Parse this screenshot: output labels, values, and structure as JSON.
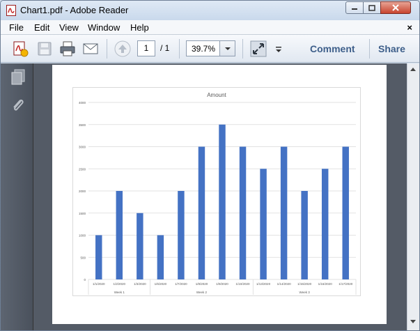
{
  "window": {
    "title": "Chart1.pdf - Adobe Reader"
  },
  "menu": {
    "items": [
      "File",
      "Edit",
      "View",
      "Window",
      "Help"
    ],
    "close_label": "×"
  },
  "toolbar": {
    "page_current": "1",
    "page_total": "/ 1",
    "zoom": "39.7%",
    "comment_label": "Comment",
    "share_label": "Share"
  },
  "chart_data": {
    "type": "bar",
    "title": "Amount",
    "categories": [
      "1/1/2020",
      "1/2/2020",
      "1/3/2020",
      "1/6/2020",
      "1/7/2020",
      "1/8/2020",
      "1/9/2020",
      "1/10/2020",
      "1/13/2020",
      "1/14/2020",
      "1/15/2020",
      "1/16/2020",
      "1/17/2020"
    ],
    "groups": [
      {
        "label": "Week 1",
        "count": 3
      },
      {
        "label": "Week 2",
        "count": 5
      },
      {
        "label": "Week 3",
        "count": 5
      }
    ],
    "series": [
      {
        "values": [
          1000,
          2000,
          1500,
          1000,
          2000,
          3000,
          3500,
          3000,
          2500,
          3000,
          2000,
          2500,
          3000
        ]
      }
    ],
    "ylim": [
      0,
      4000
    ],
    "yticks": [
      "0",
      "500",
      "1000",
      "1500",
      "2000",
      "2500",
      "3000",
      "3500",
      "4000"
    ],
    "bar_color": "#4472c4",
    "grid": true
  }
}
